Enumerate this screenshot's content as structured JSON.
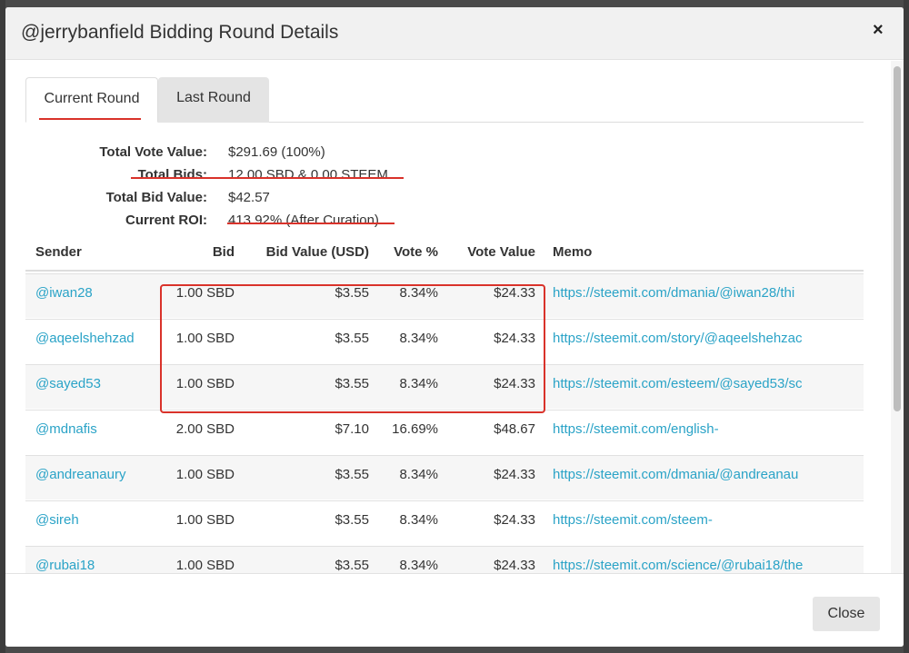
{
  "modal": {
    "title": "@jerrybanfield Bidding Round Details",
    "close_icon": "×",
    "footer_close": "Close"
  },
  "tabs": [
    {
      "label": "Current Round",
      "active": true
    },
    {
      "label": "Last Round",
      "active": false
    }
  ],
  "summary": {
    "total_vote_value_label": "Total Vote Value:",
    "total_vote_value": "$291.69 (100%)",
    "total_bids_label": "Total Bids:",
    "total_bids": "12.00 SBD & 0.00 STEEM",
    "total_bid_value_label": "Total Bid Value:",
    "total_bid_value": "$42.57",
    "current_roi_label": "Current ROI:",
    "current_roi": "413.92% (After Curation)"
  },
  "table": {
    "headers": [
      "Sender",
      "Bid",
      "Bid Value (USD)",
      "Vote %",
      "Vote Value",
      "Memo"
    ],
    "rows": [
      {
        "sender": "@iwan28",
        "bid": "1.00 SBD",
        "bid_value": "$3.55",
        "vote_pct": "8.34%",
        "vote_value": "$24.33",
        "memo": "https://steemit.com/dmania/@iwan28/thi"
      },
      {
        "sender": "@aqeelshehzad",
        "bid": "1.00 SBD",
        "bid_value": "$3.55",
        "vote_pct": "8.34%",
        "vote_value": "$24.33",
        "memo": "https://steemit.com/story/@aqeelshehzac"
      },
      {
        "sender": "@sayed53",
        "bid": "1.00 SBD",
        "bid_value": "$3.55",
        "vote_pct": "8.34%",
        "vote_value": "$24.33",
        "memo": "https://steemit.com/esteem/@sayed53/sc"
      },
      {
        "sender": "@mdnafis",
        "bid": "2.00 SBD",
        "bid_value": "$7.10",
        "vote_pct": "16.69%",
        "vote_value": "$48.67",
        "memo": "https://steemit.com/english-"
      },
      {
        "sender": "@andreanaury",
        "bid": "1.00 SBD",
        "bid_value": "$3.55",
        "vote_pct": "8.34%",
        "vote_value": "$24.33",
        "memo": "https://steemit.com/dmania/@andreanau"
      },
      {
        "sender": "@sireh",
        "bid": "1.00 SBD",
        "bid_value": "$3.55",
        "vote_pct": "8.34%",
        "vote_value": "$24.33",
        "memo": "https://steemit.com/steem-"
      },
      {
        "sender": "@rubai18",
        "bid": "1.00 SBD",
        "bid_value": "$3.55",
        "vote_pct": "8.34%",
        "vote_value": "$24.33",
        "memo": "https://steemit.com/science/@rubai18/the"
      }
    ]
  },
  "colors": {
    "link": "#2aa3c7",
    "annotation": "#d9322a"
  }
}
